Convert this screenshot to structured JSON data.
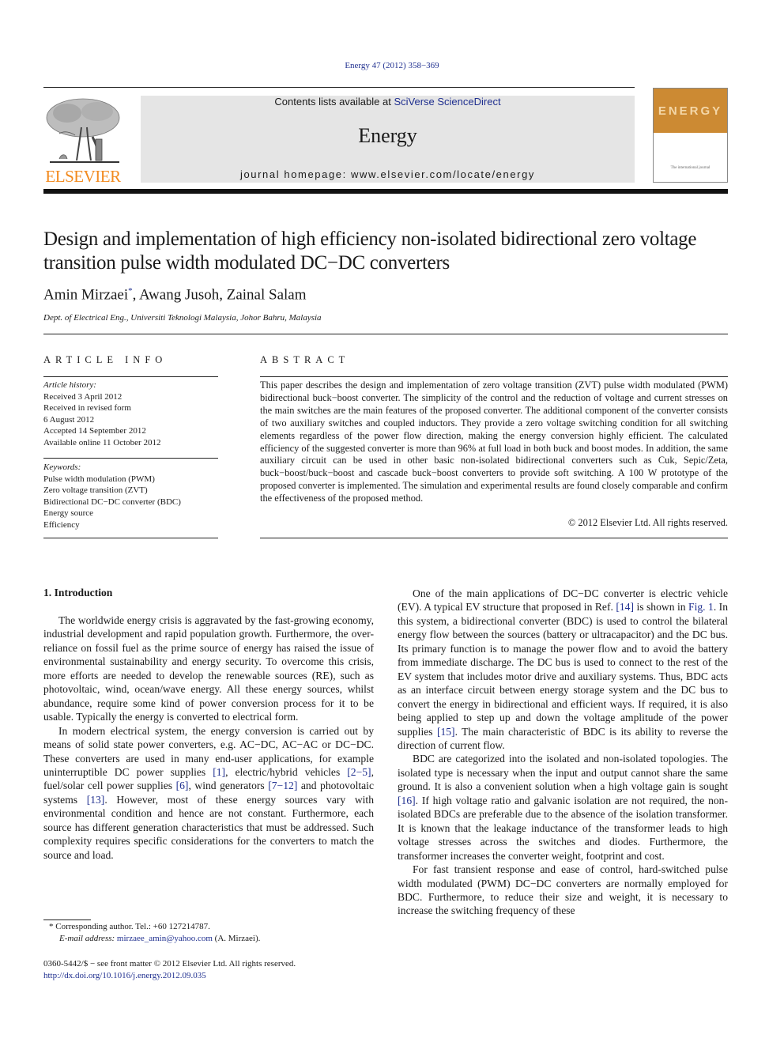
{
  "header": {
    "citation": "Energy 47 (2012) 358−369",
    "publisher_logo_text": "ELSEVIER",
    "contents_prefix": "Contents lists available at ",
    "contents_link": "SciVerse ScienceDirect",
    "journal_name": "Energy",
    "homepage": "journal homepage: www.elsevier.com/locate/energy",
    "cover_title": "ENERGY",
    "cover_subtitle": "The international journal",
    "colors": {
      "elsevier_orange": "#f28a1e",
      "link_blue": "#1f2f8f",
      "banner_gray": "#e5e5e5",
      "cover_orange": "#cc8a33"
    }
  },
  "article": {
    "title": "Design and implementation of high efficiency non-isolated bidirectional zero voltage transition pulse width modulated DC−DC converters",
    "authors": "Amin Mirzaei",
    "authors_mark": "*",
    "authors_rest": ", Awang Jusoh, Zainal Salam",
    "affiliation": "Dept. of Electrical Eng., Universiti Teknologi Malaysia, Johor Bahru, Malaysia"
  },
  "article_info": {
    "heading": "ARTICLE INFO",
    "history_label": "Article history:",
    "history": [
      "Received 3 April 2012",
      "Received in revised form",
      "6 August 2012",
      "Accepted 14 September 2012",
      "Available online 11 October 2012"
    ],
    "keywords_label": "Keywords:",
    "keywords": [
      "Pulse width modulation (PWM)",
      "Zero voltage transition (ZVT)",
      "Bidirectional DC−DC converter (BDC)",
      "Energy source",
      "Efficiency"
    ]
  },
  "abstract": {
    "heading": "ABSTRACT",
    "text": "This paper describes the design and implementation of zero voltage transition (ZVT) pulse width modulated (PWM) bidirectional buck−boost converter. The simplicity of the control and the reduction of voltage and current stresses on the main switches are the main features of the proposed converter. The additional component of the converter consists of two auxiliary switches and coupled inductors. They provide a zero voltage switching condition for all switching elements regardless of the power flow direction, making the energy conversion highly efficient. The calculated efficiency of the suggested converter is more than 96% at full load in both buck and boost modes. In addition, the same auxiliary circuit can be used in other basic non-isolated bidirectional converters such as Cuk, Sepic/Zeta, buck−boost/buck−boost and cascade buck−boost converters to provide soft switching. A 100 W prototype of the proposed converter is implemented. The simulation and experimental results are found closely comparable and confirm the effectiveness of the proposed method.",
    "copyright": "© 2012 Elsevier Ltd. All rights reserved."
  },
  "body": {
    "section_heading": "1.  Introduction",
    "left": {
      "p1": "The worldwide energy crisis is aggravated by the fast-growing economy, industrial development and rapid population growth. Furthermore, the over-reliance on fossil fuel as the prime source of energy has raised the issue of environmental sustainability and energy security. To overcome this crisis, more efforts are needed to develop the renewable sources (RE), such as photovoltaic, wind, ocean/wave energy. All these energy sources, whilst abundance, require some kind of power conversion process for it to be usable. Typically the energy is converted to electrical form.",
      "p2_a": "In modern electrical system, the energy conversion is carried out by means of solid state power converters, e.g. AC−DC, AC−AC or DC−DC. These converters are used in many end-user applications, for example uninterruptible DC power supplies ",
      "ref1": "[1]",
      "p2_b": ", electric/hybrid vehicles ",
      "ref2": "[2−5]",
      "p2_c": ", fuel/solar cell power supplies ",
      "ref3": "[6]",
      "p2_d": ", wind generators ",
      "ref4": "[7−12]",
      "p2_e": " and photovoltaic systems ",
      "ref5": "[13]",
      "p2_f": ". However, most of these energy sources vary with environmental condition and hence are not constant. Furthermore, each source has different generation characteristics that must be addressed. Such complexity requires specific considerations for the converters to match the source and load."
    },
    "right": {
      "p1_a": "One of the main applications of DC−DC converter is electric vehicle (EV). A typical EV structure that proposed in Ref. ",
      "ref14": "[14]",
      "p1_b": " is shown in ",
      "fig1": "Fig. 1",
      "p1_c": ". In this system, a bidirectional converter (BDC) is used to control the bilateral energy flow between the sources (battery or ultracapacitor) and the DC bus. Its primary function is to manage the power flow and to avoid the battery from immediate discharge. The DC bus is used to connect to the rest of the EV system that includes motor drive and auxiliary systems. Thus, BDC acts as an interface circuit between energy storage system and the DC bus to convert the energy in bidirectional and efficient ways. If required, it is also being applied to step up and down the voltage amplitude of the power supplies ",
      "ref15": "[15]",
      "p1_d": ". The main characteristic of BDC is its ability to reverse the direction of current flow.",
      "p2_a": "BDC are categorized into the isolated and non-isolated topologies. The isolated type is necessary when the input and output cannot share the same ground. It is also a convenient solution when a high voltage gain is sought ",
      "ref16": "[16]",
      "p2_b": ". If high voltage ratio and galvanic isolation are not required, the non-isolated BDCs are preferable due to the absence of the isolation transformer. It is known that the leakage inductance of the transformer leads to high voltage stresses across the switches and diodes. Furthermore, the transformer increases the converter weight, footprint and cost.",
      "p3": "For fast transient response and ease of control, hard-switched pulse width modulated (PWM) DC−DC converters are normally employed for BDC. Furthermore, to reduce their size and weight, it is necessary to increase the switching frequency of these"
    }
  },
  "footnote": {
    "mark": "*",
    "corresponding": "Corresponding author. Tel.: +60 127214787.",
    "email_label": "E-mail address: ",
    "email": "mirzaee_amin@yahoo.com",
    "email_suffix": " (A. Mirzaei)."
  },
  "front_matter": {
    "issn_line": "0360-5442/$ − see front matter © 2012 Elsevier Ltd. All rights reserved.",
    "doi": "http://dx.doi.org/10.1016/j.energy.2012.09.035"
  }
}
